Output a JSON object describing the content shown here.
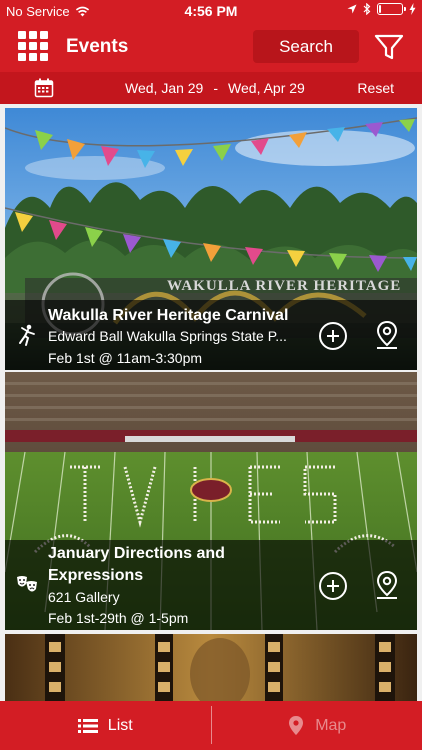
{
  "status_bar": {
    "carrier": "No Service",
    "time": "4:56 PM",
    "battery_percent": 10
  },
  "nav": {
    "title": "Events",
    "search_label": "Search",
    "grid_icon": "grid-menu-icon",
    "filter_icon": "filter-funnel-icon"
  },
  "date_bar": {
    "start": "Wed, Jan 29",
    "separator": "-",
    "end": "Wed, Apr 29",
    "reset_label": "Reset",
    "icon": "calendar-icon"
  },
  "events": [
    {
      "title": "Wakulla River Heritage Carnival",
      "venue": "Edward Ball Wakulla Springs State P...",
      "date": "Feb 1st @ 11am-3:30pm",
      "image_text": "WAKULLA RIVER HERITAGE",
      "type_icon": "dancer-icon"
    },
    {
      "title": "January Directions and Expressions",
      "venue": "621 Gallery",
      "date": "Feb 1st-29th @ 1-5pm",
      "type_icon": "theater-masks-icon"
    },
    {
      "title": "",
      "venue": "",
      "date": ""
    }
  ],
  "tabs": {
    "list_label": "List",
    "map_label": "Map"
  },
  "colors": {
    "brand_red": "#d31d24",
    "date_bar_red": "#c3161d",
    "search_bg": "#b8151b"
  }
}
